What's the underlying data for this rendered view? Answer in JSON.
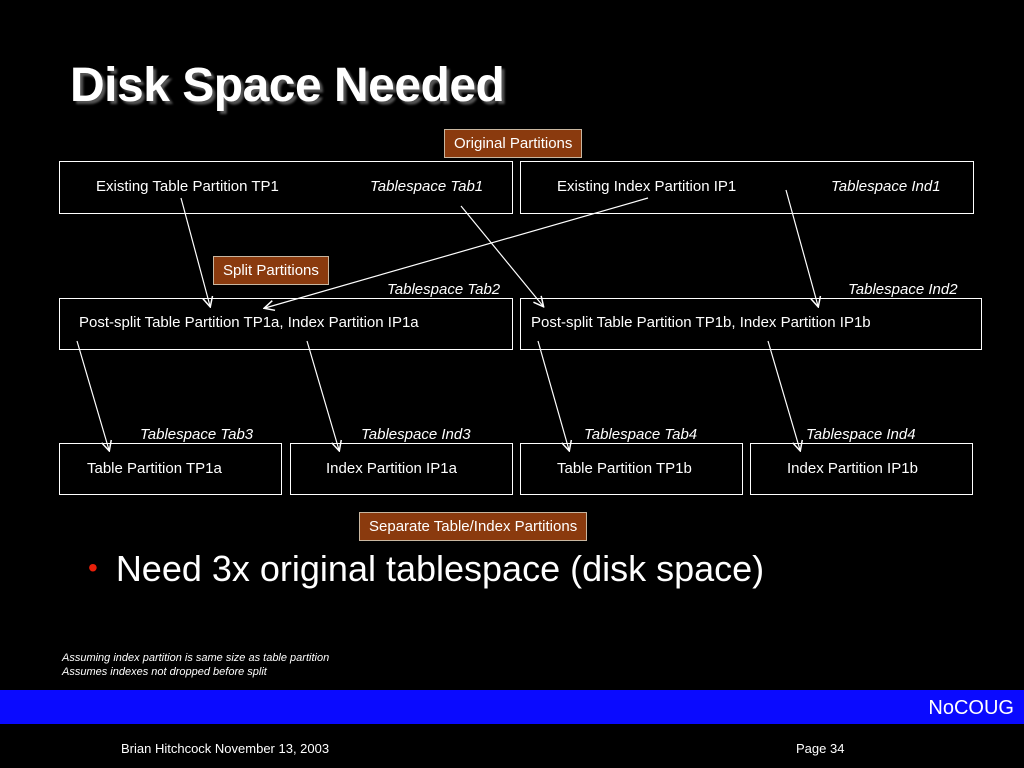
{
  "title": "Disk Space Needed",
  "labels": {
    "original": "Original Partitions",
    "split": "Split Partitions",
    "separate": "Separate Table/Index Partitions"
  },
  "row1": {
    "left_text": "Existing Table Partition TP1",
    "left_ts": "Tablespace Tab1",
    "right_text": "Existing Index Partition IP1",
    "right_ts": "Tablespace Ind1"
  },
  "row2": {
    "left_ts": "Tablespace Tab2",
    "left_text": "Post-split Table Partition TP1a, Index Partition IP1a",
    "right_ts": "Tablespace Ind2",
    "right_text": "Post-split Table Partition TP1b, Index Partition IP1b"
  },
  "row3": [
    {
      "ts": "Tablespace Tab3",
      "text": "Table Partition TP1a"
    },
    {
      "ts": "Tablespace Ind3",
      "text": "Index Partition IP1a"
    },
    {
      "ts": "Tablespace Tab4",
      "text": "Table Partition TP1b"
    },
    {
      "ts": "Tablespace Ind4",
      "text": "Index Partition IP1b"
    }
  ],
  "bullet": "Need 3x original tablespace (disk space)",
  "notes": [
    "Assuming index partition is same size as table partition",
    "Assumes indexes not dropped before split"
  ],
  "footer": {
    "brand": "NoCOUG",
    "author_date": "Brian Hitchcock  November 13, 2003",
    "page": "Page 34"
  }
}
